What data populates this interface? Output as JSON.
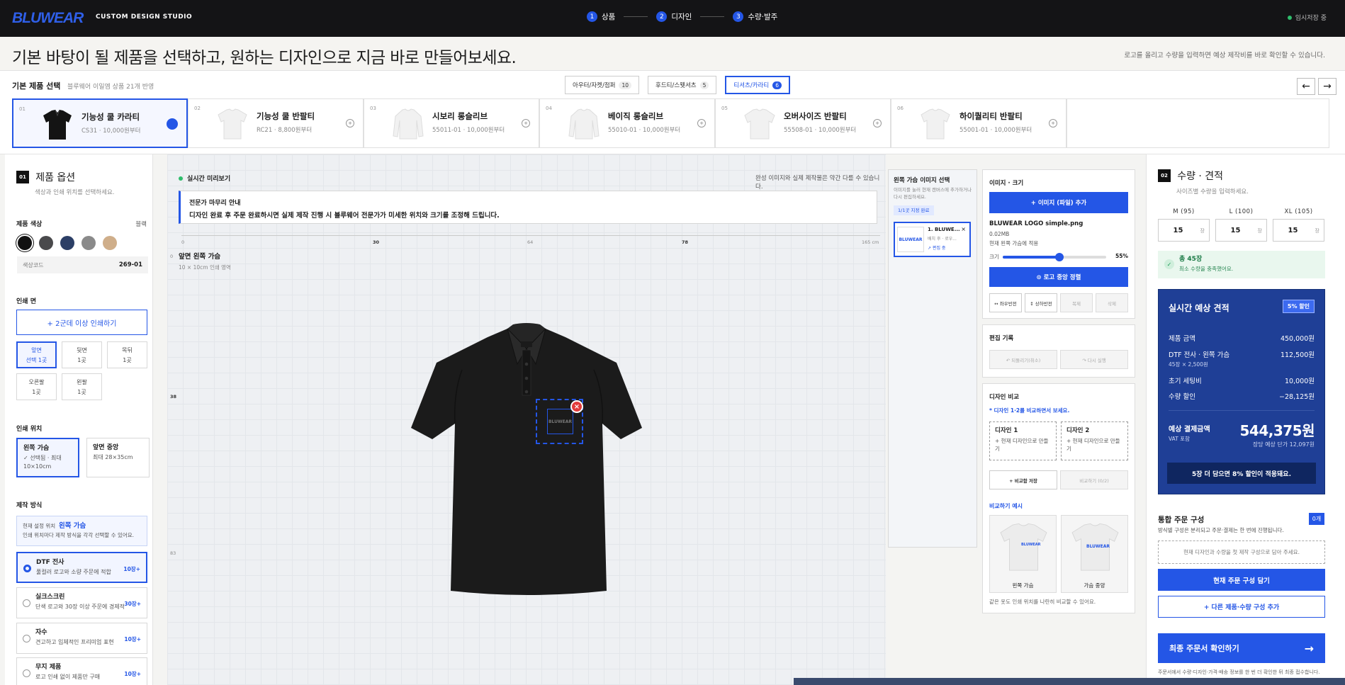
{
  "header": {
    "logo": "BLUWEAR",
    "studio": "CUSTOM DESIGN STUDIO",
    "steps": [
      {
        "num": "1",
        "label": "상품"
      },
      {
        "num": "2",
        "label": "디자인"
      },
      {
        "num": "3",
        "label": "수량·발주"
      }
    ],
    "saved": "임시저장 중"
  },
  "hero": {
    "title": "기본 바탕이 될 제품을 선택하고, 원하는 디자인으로 지금 바로 만들어보세요.",
    "subtitle": "로고를 올리고 수량을 입력하면 예상 제작비를 바로 확인할 수 있습니다."
  },
  "products": {
    "title": "기본 제품 선택",
    "subtitle": "블루웨어 이일엠 상품 21개 반영",
    "categories": [
      {
        "label": "아우터/자켓/점퍼",
        "count": "10"
      },
      {
        "label": "후드티/스웻셔츠",
        "count": "5"
      },
      {
        "label": "티셔츠/카라티",
        "count": "6"
      }
    ],
    "prev": "←",
    "next": "→",
    "items": [
      {
        "idx": "01",
        "name": "기능성 쿨 카라티",
        "meta": "CS31 · 10,000원부터"
      },
      {
        "idx": "02",
        "name": "기능성 쿨 반팔티",
        "meta": "RC21 · 8,800원부터"
      },
      {
        "idx": "03",
        "name": "시보리 롱슬리브",
        "meta": "55011-01 · 10,000원부터"
      },
      {
        "idx": "04",
        "name": "베이직 롱슬리브",
        "meta": "55010-01 · 10,000원부터"
      },
      {
        "idx": "05",
        "name": "오버사이즈 반팔티",
        "meta": "55508-01 · 10,000원부터"
      },
      {
        "idx": "06",
        "name": "하이퀄리티 반팔티",
        "meta": "55001-01 · 10,000원부터"
      }
    ]
  },
  "options": {
    "num": "01",
    "title": "제품 옵션",
    "subtitle": "색상과 인쇄 위치를 선택하세요.",
    "color_label": "제품 색상",
    "color_value": "블랙",
    "colors": [
      "#111111",
      "#4a4a4c",
      "#2c3f66",
      "#8a8a8a",
      "#cfae8a"
    ],
    "code_label": "색상코드",
    "code_value": "269-01",
    "face_label": "인쇄 면",
    "add_face": "+ 2군데 이상 인쇄하기",
    "faces": [
      {
        "name": "앞면",
        "sub": "선택 1곳"
      },
      {
        "name": "뒷면",
        "sub": "1곳"
      },
      {
        "name": "목뒤",
        "sub": "1곳"
      },
      {
        "name": "오른팔",
        "sub": "1곳"
      },
      {
        "name": "왼팔",
        "sub": "1곳"
      }
    ],
    "position_label": "인쇄 위치",
    "positions": [
      {
        "name": "왼쪽 가슴",
        "line1": "✓ 선택됨 · 최대",
        "line2": "10×10cm"
      },
      {
        "name": "앞면 중앙",
        "line1": "최대 28×35cm",
        "line2": ""
      }
    ],
    "method_label": "제작 방식",
    "current_pos_label": "현재 설정 위치",
    "current_pos_value": "왼쪽 가슴",
    "current_pos_note": "인쇄 위치마다 제작 방식을 각각 선택할 수 있어요.",
    "methods": [
      {
        "name": "DTF 전사",
        "desc": "풀컬러 로고와 소량 주문에 적합",
        "price": "10장+"
      },
      {
        "name": "실크스크린",
        "desc": "단색 로고와 30장 이상 주문에 경제적",
        "price": "30장+"
      },
      {
        "name": "자수",
        "desc": "견고하고 입체적인 프리미엄 표현",
        "price": "10장+"
      },
      {
        "name": "무지 제품",
        "desc": "로고 인쇄 없이 제품만 구매",
        "price": "10장+"
      }
    ]
  },
  "preview": {
    "live": "실시간 미리보기",
    "note": "완성 이미지와 실제 제작물은 약간 다를 수 있습니다.",
    "guide_title": "전문가 마무리 안내",
    "guide_desc": "디자인 완료 후 주문 완료하시면 실제 제작 진행 시 블루웨어 전문가가 미세한 위치와 크기를 조정해 드립니다.",
    "ruler": [
      "0",
      "30",
      "64",
      "78",
      "165 cm"
    ],
    "ruler_left": [
      "0",
      "38",
      "83"
    ],
    "zone": "앞면 왼쪽 가슴",
    "zone_sub": "10 × 10cm 인쇄 영역",
    "print_text": "BLUWEAR",
    "delete": "×"
  },
  "imgselect": {
    "title": "왼쪽 가슴 이미지 선택",
    "desc": "이미지를 눌러 현재 캔버스에 추가하거나 다시 편집하세요.",
    "badge": "1/1곳 지정 완료",
    "item_name": "1. BLUWE...",
    "item_sub": "배치 후 · 로우...",
    "item_edit": "↗ 편집 중",
    "item_thumb": "BLUWEAR",
    "close": "×"
  },
  "imagepanel": {
    "title": "이미지 · 크기",
    "add": "+ 이미지 (파일) 추가",
    "file": "BLUWEAR LOGO simple.png",
    "size": "0.02MB",
    "applied": "현재 왼쪽 가슴에 적용",
    "size_label": "크기",
    "size_value": "55%",
    "center": "⊙ 로고 중앙 정렬",
    "tools": [
      "↔ 좌우반전",
      "↕ 상하반전",
      "복제",
      "삭제"
    ]
  },
  "history": {
    "title": "편집 기록",
    "undo": "↶ 되돌리기(취소)",
    "redo": "↷ 다시 실행"
  },
  "compare": {
    "title": "디자인 비교",
    "hint": "* 디자인 1·2를 비교하면서 보세요.",
    "d1_title": "디자인 1",
    "d1_desc": "+ 현재 디자인으로 만들기",
    "d2_title": "디자인 2",
    "d2_desc": "+ 현재 디자인으로 만들기",
    "save": "+ 비교함 저장",
    "view": "비교하기 (0/2)",
    "example_title": "비교하기 예시",
    "ex1": "왼쪽 가슴",
    "ex2": "가슴 중앙",
    "ex_logo": "BLUWEAR",
    "note": "같은 옷도 인쇄 위치를 나란히 비교할 수 있어요."
  },
  "quantity": {
    "num": "02",
    "title": "수량 · 견적",
    "subtitle": "사이즈별 수량을 입력하세요.",
    "sizes": [
      {
        "label": "M (95)",
        "value": "15",
        "unit": "장"
      },
      {
        "label": "L (100)",
        "value": "15",
        "unit": "장"
      },
      {
        "label": "XL (105)",
        "value": "15",
        "unit": "장"
      }
    ],
    "total": "총 45장",
    "total_note": "최소 수량을 충족했어요.",
    "check": "✓"
  },
  "quote": {
    "title": "실시간 예상 견적",
    "discount": "5% 할인",
    "rows": [
      {
        "k": "제품 금액",
        "v": "450,000원"
      },
      {
        "k": "DTF 전사 · 왼쪽 가슴",
        "v": "112,500원"
      },
      {
        "k": "초기 세팅비",
        "v": "10,000원"
      },
      {
        "k": "수량 할인",
        "v": "−28,125원"
      }
    ],
    "row_sub": "45장 × 2,500원",
    "grand_label": "예상 결제금액",
    "grand_sub": "VAT 포함",
    "grand_value": "544,375원",
    "unit_price": "장당 예상 단가 12,097원",
    "promo": "5장 더 담으면 8% 할인이 적용돼요."
  },
  "combo": {
    "title": "통합 주문 구성",
    "subtitle": "방식별 구성은 분리되고 주문·결제는 한 번에 진행됩니다.",
    "count": "0개",
    "empty": "현재 디자인과 수량을 첫 제작 구성으로 담아 주세요.",
    "add": "현재 주문 구성 담기",
    "other": "+ 다른 제품·수량 구성 추가",
    "final": "최종 주문서 확인하기",
    "final_arrow": "→",
    "final_note": "주문서에서 수량·디자인·가격·배송 정보를 한 번 더 확인한 뒤 최종 접수합니다."
  }
}
